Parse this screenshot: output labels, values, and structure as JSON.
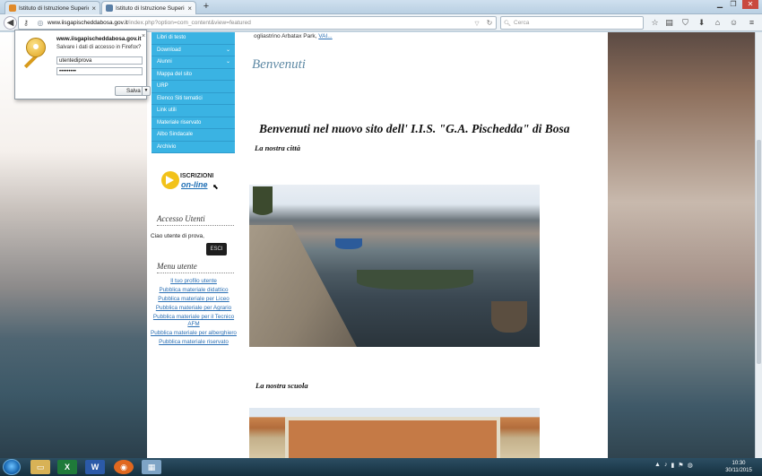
{
  "browser": {
    "tabs": [
      {
        "title": "Istituto di Istruzione Superiore ...",
        "close": "×",
        "active": false
      },
      {
        "title": "Istituto di Istruzione Superiore \"...",
        "close": "×",
        "active": true
      }
    ],
    "new_tab": "+",
    "url_domain": "www.iisgapischeddabosa.gov.it",
    "url_path": "/index.php?option=com_content&view=featured",
    "search_placeholder": "Cerca"
  },
  "password_popup": {
    "domain": "www.iisgapischeddabosa.gov.it",
    "question": "Salvare i dati di accesso in Firefox?",
    "username": "utentediprova",
    "password_mask": "•••••••••",
    "save_label": "Salva",
    "close": "×"
  },
  "sidebar": {
    "menu": [
      {
        "label": "Libri di testo",
        "has_sub": false
      },
      {
        "label": "Download",
        "has_sub": true
      },
      {
        "label": "Alunni",
        "has_sub": true
      },
      {
        "label": "Mappa del sito",
        "has_sub": false
      },
      {
        "label": "URP",
        "has_sub": false
      },
      {
        "label": "Elenco Siti tematici",
        "has_sub": false
      },
      {
        "label": "Link utili",
        "has_sub": false
      },
      {
        "label": "Materiale riservato",
        "has_sub": false
      },
      {
        "label": "Albo Sindacale",
        "has_sub": false
      },
      {
        "label": "Archivio",
        "has_sub": false
      }
    ],
    "iscrizioni": {
      "line1": "ISCRIZIONI",
      "line2": "on-line"
    },
    "accesso_title": "Accesso Utenti",
    "greeting": "Ciao utente di prova,",
    "logout_label": "ESCI",
    "user_menu_title": "Menu utente",
    "user_menu": [
      "Il tuo profilo utente",
      "Pubblica materiale didattico",
      "Pubblica materiale per Liceo",
      "Pubblica materiale per Agrario",
      "Pubblica materiale per il Tecnico AFM",
      "Pubblica materiale per alberghiero",
      "Pubblica materiale riservato"
    ]
  },
  "main": {
    "top_text": "ogliastrino Arbatax Park,",
    "top_link": "VAI...",
    "section_title": "Benvenuti",
    "headline": "Benvenuti nel nuovo sito dell' I.I.S. \"G.A. Pischedda\" di Bosa",
    "subtitle_city": "La nostra città",
    "subtitle_school": "La nostra scuola"
  },
  "taskbar": {
    "clock_time": "10:30",
    "clock_date": "30/11/2015"
  }
}
